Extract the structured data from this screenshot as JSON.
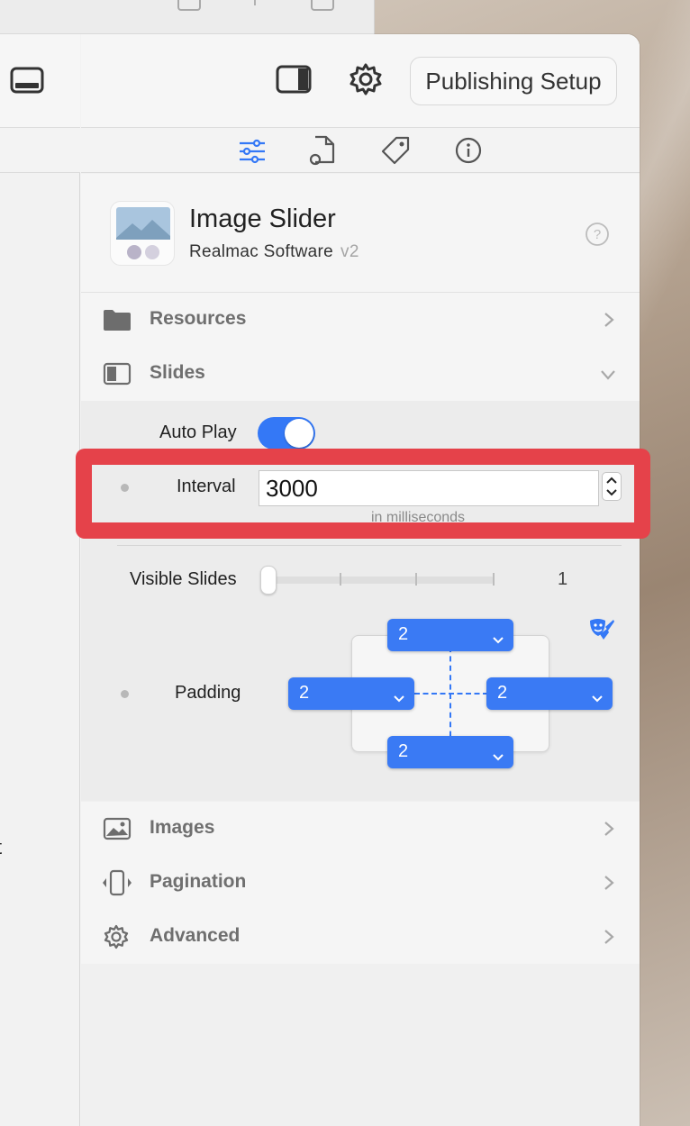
{
  "toolbar": {
    "publish_label": "Publishing Setup"
  },
  "tabs": [
    "sliders-icon",
    "page-settings-icon",
    "tag-icon",
    "info-icon"
  ],
  "plugin": {
    "title": "Image Slider",
    "vendor": "Realmac Software",
    "version": "v2"
  },
  "sections": {
    "resources": "Resources",
    "slides": "Slides",
    "images": "Images",
    "pagination": "Pagination",
    "advanced": "Advanced"
  },
  "slides": {
    "autoplay_label": "Auto Play",
    "autoplay_on": true,
    "interval_label": "Interval",
    "interval_value": "3000",
    "interval_hint": "in milliseconds",
    "visible_label": "Visible Slides",
    "visible_value": "1",
    "padding_label": "Padding",
    "padding": {
      "top": "2",
      "left": "2",
      "right": "2",
      "bottom": "2"
    }
  },
  "left_pane": {
    "cut_text": "t"
  },
  "colors": {
    "accent": "#3478f6",
    "highlight": "#e5424a"
  }
}
